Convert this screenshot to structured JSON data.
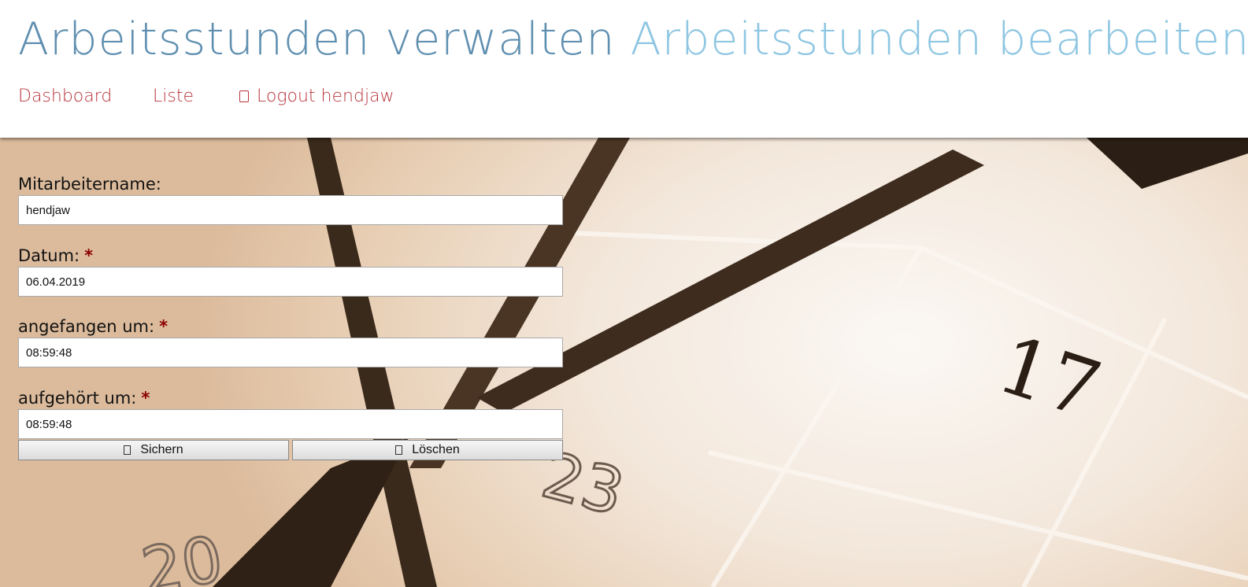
{
  "header": {
    "title_main": "Arbeitsstunden verwalten",
    "title_sub": "Arbeitsstunden bearbeiten",
    "title_main_color": "#5f8fb0",
    "title_sub_color": "#8ec6e2"
  },
  "nav": {
    "dashboard": "Dashboard",
    "liste": "Liste",
    "logout": "Logout hendjaw",
    "link_color": "#b8343c",
    "logout_icon": "lock-icon"
  },
  "form": {
    "employee": {
      "label": "Mitarbeitername:",
      "value": "hendjaw"
    },
    "date": {
      "label": "Datum:",
      "required": "*",
      "value": "06.04.2019"
    },
    "start": {
      "label": "angefangen um:",
      "required": "*",
      "value": "08:59:48"
    },
    "end": {
      "label": "aufgehört um:",
      "required": "*",
      "value": "08:59:48"
    },
    "save_label": "Sichern",
    "delete_label": "Löschen",
    "save_icon": "save-icon",
    "delete_icon": "delete-icon"
  },
  "background": {
    "numbers": [
      "17",
      "23",
      "20"
    ]
  }
}
